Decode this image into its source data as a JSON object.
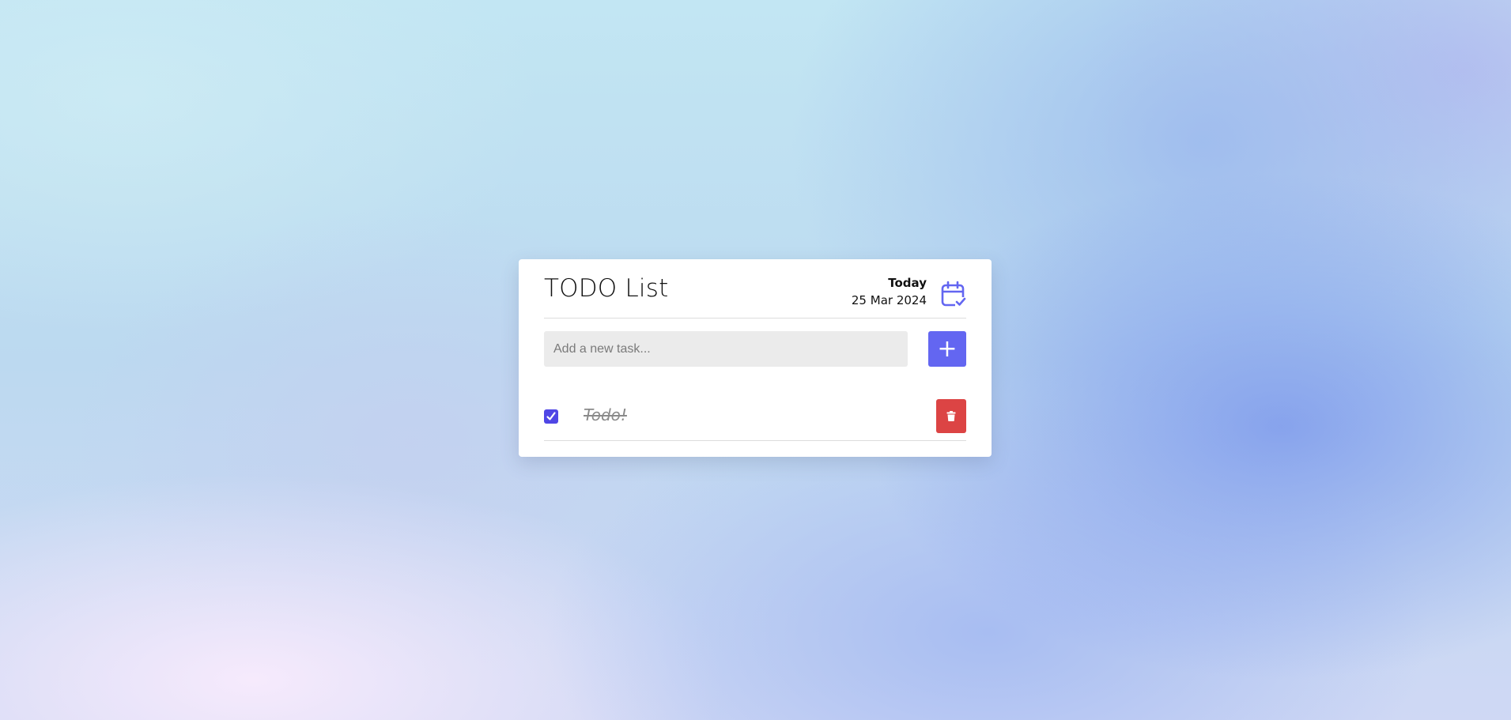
{
  "app": {
    "title": "TODO List"
  },
  "date": {
    "label": "Today",
    "value": "25 Mar 2024"
  },
  "icons": {
    "calendar": "calendar-check-icon",
    "add": "plus-icon",
    "delete": "trash-icon",
    "check": "check-icon"
  },
  "new_task": {
    "placeholder": "Add a new task...",
    "value": "",
    "add_label": "+"
  },
  "todos": [
    {
      "text": "Todo!",
      "completed": true
    }
  ],
  "colors": {
    "accent": "#6366f1",
    "checkbox": "#4f46e5",
    "delete": "#dc4444",
    "input_bg": "#ebebeb",
    "completed_text": "#8a8a8a"
  }
}
